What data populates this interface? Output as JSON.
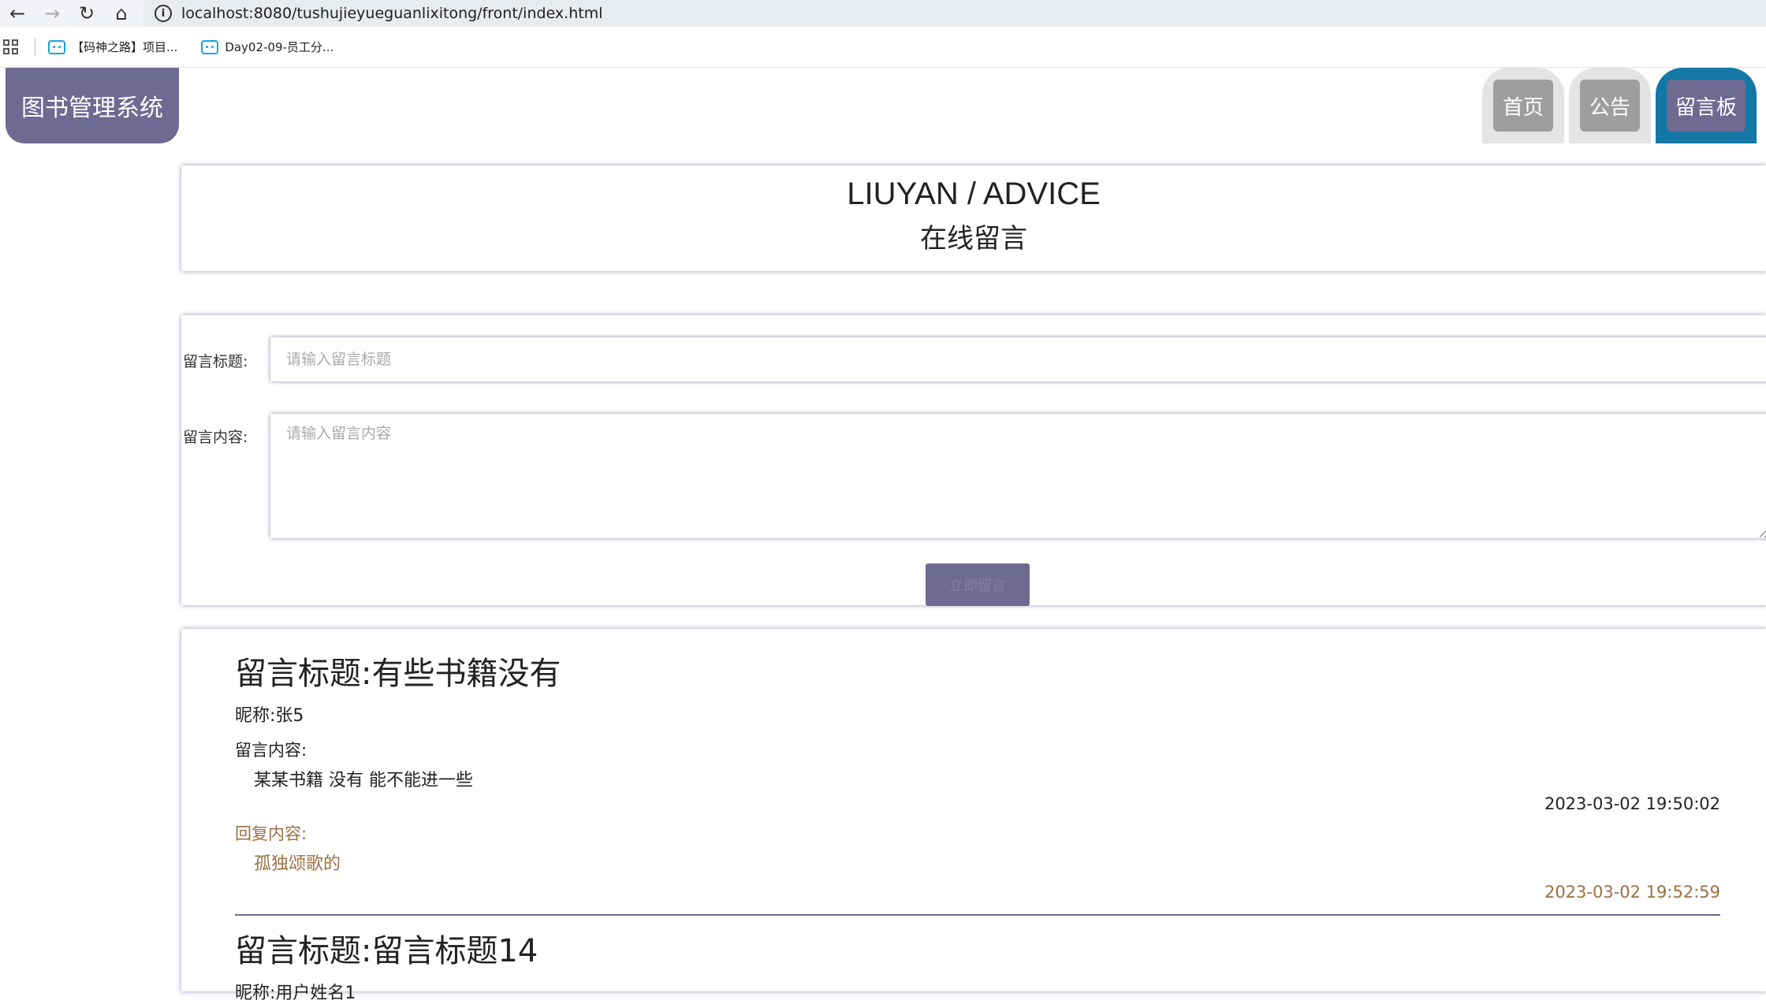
{
  "browser": {
    "url": "localhost:8080/tushujieyueguanlixitong/front/index.html",
    "bookmarks": [
      "【码神之路】项目...",
      "Day02-09-员工分..."
    ]
  },
  "header": {
    "logo": "图书管理系统",
    "nav": [
      "首页",
      "公告",
      "留言板"
    ],
    "active_nav": "留言板"
  },
  "section": {
    "title_en": "LIUYAN / ADVICE",
    "title_cn": "在线留言"
  },
  "form": {
    "title_label": "留言标题:",
    "title_placeholder": "请输入留言标题",
    "content_label": "留言内容:",
    "content_placeholder": "请输入留言内容",
    "submit_label": "立即留言"
  },
  "messages": [
    {
      "title": "留言标题:有些书籍没有",
      "nickname": "昵称:张5",
      "content_label": "留言内容:",
      "content": "某某书籍 没有 能不能进一些",
      "time": "2023-03-02 19:50:02",
      "reply_label": "回复内容:",
      "reply": "孤独颂歌的",
      "reply_time": "2023-03-02 19:52:59"
    },
    {
      "title": "留言标题:留言标题14",
      "nickname": "昵称:用户姓名1"
    }
  ],
  "colors": {
    "brand": "#6f6a92",
    "active_tab": "#1378a5",
    "reply": "#9b7042"
  }
}
